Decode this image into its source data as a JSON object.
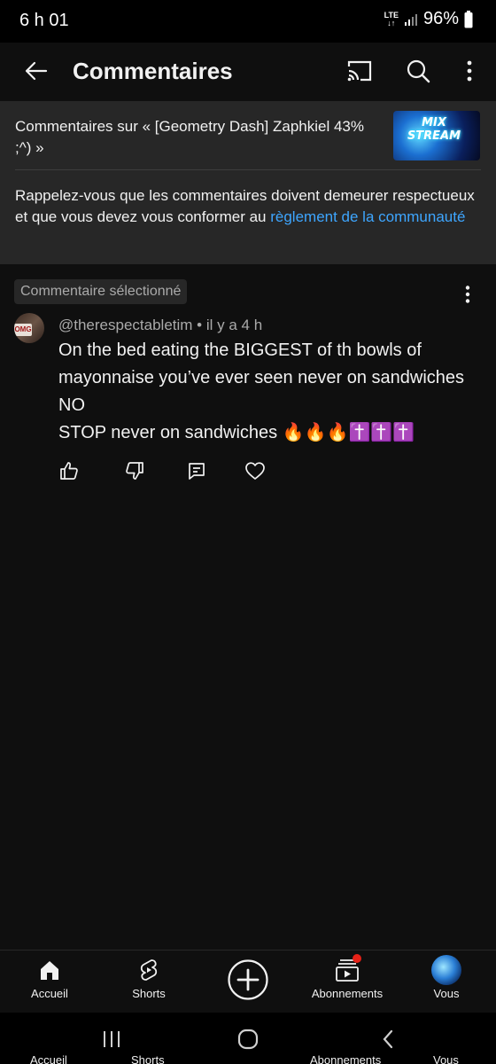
{
  "status_bar": {
    "time": "6 h 01",
    "network": "LTE",
    "battery": "96%"
  },
  "app_bar": {
    "title": "Commentaires",
    "icons": [
      "back-icon",
      "cast-icon",
      "search-icon",
      "more-vert-icon"
    ]
  },
  "video_ref": {
    "text": "Commentaires sur « [Geometry Dash] Zaphkiel 43% ;^) »",
    "thumbnail_text": "MIX STREAM"
  },
  "notice": {
    "text": "Rappelez-vous que les commentaires doivent demeurer respectueux et que vous devez vous conformer au ",
    "link": "règlement de la communauté"
  },
  "selected_comment": {
    "label": "Commentaire sélectionné",
    "avatar_text": "OMG",
    "author": "@therespectabletim",
    "time": "il y a 4 h",
    "meta": "@therespectabletim • il y a 4 h",
    "body_line1": "On the bed eating the BIGGEST of th bowls of mayonnaise you’ve ever seen never on sandwiches NO",
    "body_line2": "STOP never on sandwiches 🔥🔥🔥✝️✝️✝️",
    "actions": [
      "like-icon",
      "dislike-icon",
      "reply-icon",
      "heart-icon"
    ]
  },
  "bottom_nav": {
    "items": [
      {
        "label": "Accueil",
        "icon": "home-icon"
      },
      {
        "label": "Shorts",
        "icon": "shorts-icon"
      },
      {
        "label": "",
        "icon": "create-icon"
      },
      {
        "label": "Abonnements",
        "icon": "subscriptions-icon"
      },
      {
        "label": "Vous",
        "icon": "avatar"
      }
    ]
  },
  "colors": {
    "background": "#0f0f0f",
    "panel": "#272727",
    "link": "#3ea6ff",
    "notification_dot": "#e62117"
  }
}
